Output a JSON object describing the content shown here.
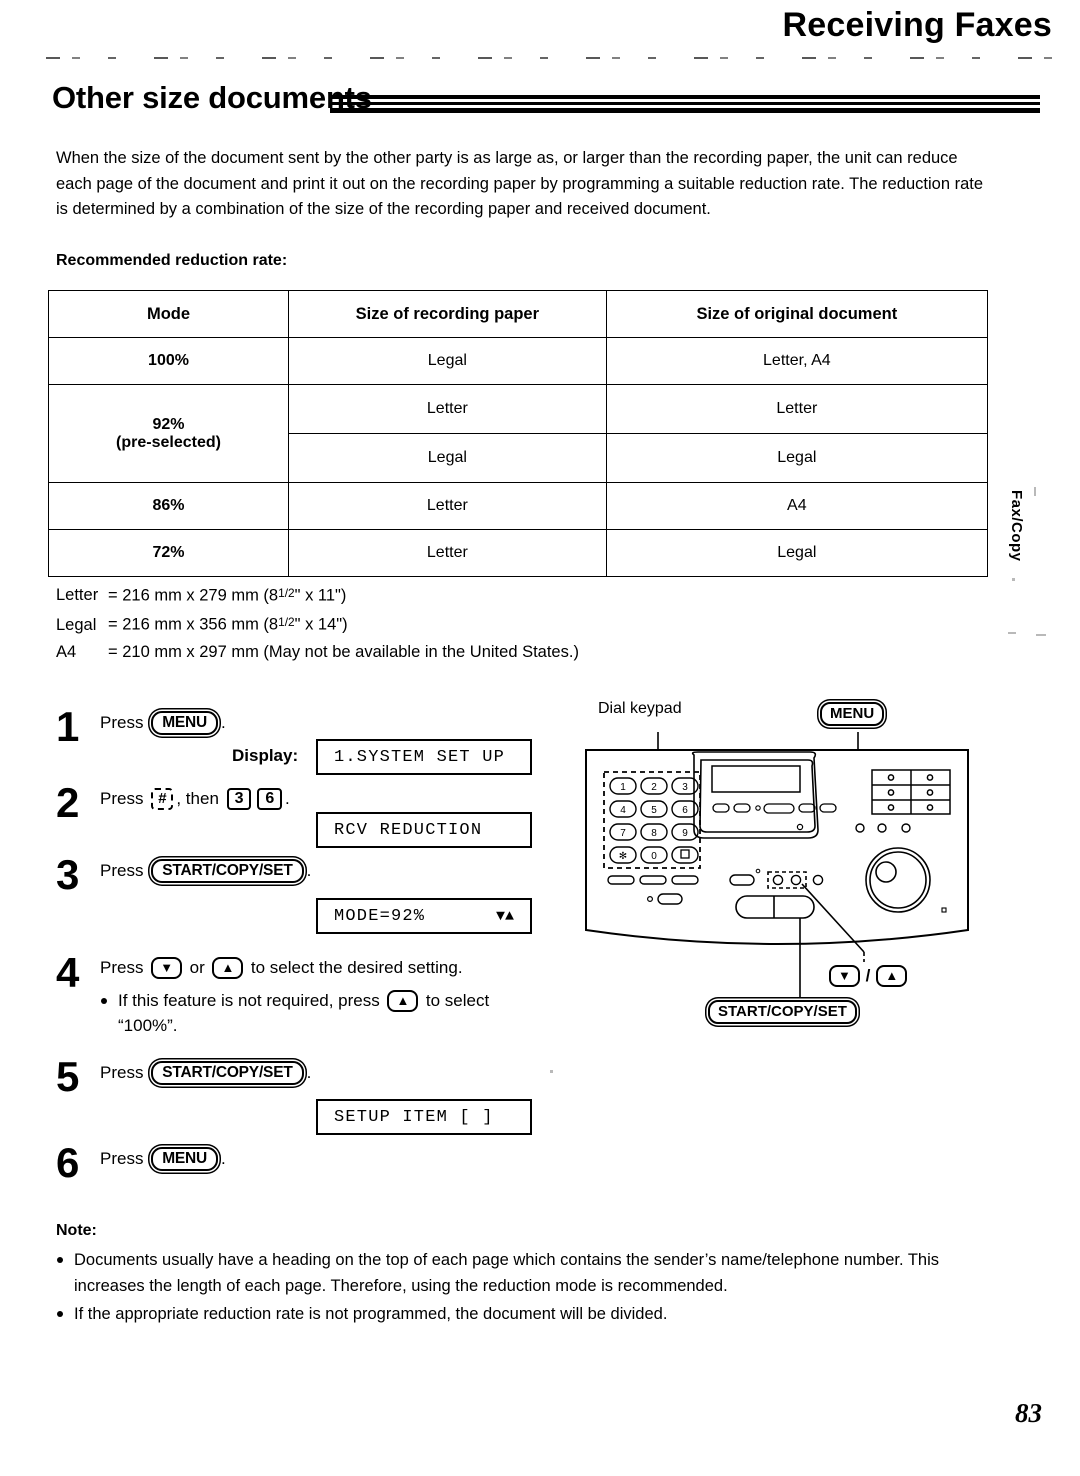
{
  "header": {
    "chapter_title": "Receiving Faxes",
    "section_title": "Other size documents"
  },
  "intro": {
    "paragraph1": "When the size of the document sent by the other party is as large as, or larger than the recording paper, the unit can reduce each page of the document and print it out on the recording paper by programming a suitable reduction rate.",
    "paragraph2": "The reduction rate is determined by a combination of the size of the recording paper and received document.",
    "table_label": "Recommended reduction rate:"
  },
  "table": {
    "headers": [
      "Mode",
      "Size of recording paper",
      "Size of original document"
    ],
    "rows": [
      {
        "mode": "100%",
        "mode_sub": "",
        "paper": "Legal",
        "original": "Letter, A4"
      },
      {
        "mode": "92%",
        "mode_sub": "(pre-selected)",
        "paper": "Letter",
        "original": "Letter"
      },
      {
        "mode": "",
        "mode_sub": "",
        "paper": "Legal",
        "original": "Legal"
      },
      {
        "mode": "86%",
        "mode_sub": "",
        "paper": "Letter",
        "original": "A4"
      },
      {
        "mode": "72%",
        "mode_sub": "",
        "paper": "Letter",
        "original": "Legal"
      }
    ]
  },
  "sizes": [
    {
      "name": "Letter",
      "eq": "= 216 mm x 279 mm (8",
      "frac": "1/2",
      "tail": "\" x 11\")"
    },
    {
      "name": "Legal",
      "eq": "= 216 mm x 356 mm (8",
      "frac": "1/2",
      "tail": "\" x 14\")"
    },
    {
      "name": "A4",
      "eq": "= 210 mm x 297 mm (May not be available in the United States.)",
      "frac": "",
      "tail": ""
    }
  ],
  "steps": {
    "s1": {
      "num": "1",
      "press": "Press",
      "key": "MENU",
      "period": ".",
      "display_label": "Display:",
      "lcd": "1.SYSTEM SET UP"
    },
    "s2": {
      "num": "2",
      "press": "Press",
      "key_hash": "#",
      "then": ", then",
      "key_a": "3",
      "key_b": "6",
      "period": ".",
      "lcd": "RCV REDUCTION"
    },
    "s3": {
      "num": "3",
      "press": "Press",
      "key": "START/COPY/SET",
      "period": ".",
      "lcd": "MODE=92%",
      "lcd_arrows": "▼▲"
    },
    "s4": {
      "num": "4",
      "line1_a": "Press",
      "key_down": "▼",
      "line1_b": "or",
      "key_up": "▲",
      "line1_c": "to select the desired setting.",
      "bullet_a": "If this feature is not required, press",
      "bullet_key": "▲",
      "bullet_b": "to select",
      "bullet_c": "“100%”."
    },
    "s5": {
      "num": "5",
      "press": "Press",
      "key": "START/COPY/SET",
      "period": ".",
      "lcd": "SETUP ITEM [  ]"
    },
    "s6": {
      "num": "6",
      "press": "Press",
      "key": "MENU",
      "period": "."
    }
  },
  "device": {
    "callouts": {
      "dial_keypad": "Dial keypad",
      "menu": "MENU",
      "start_copy_set": "START/COPY/SET",
      "down_key": "▼",
      "slash": "/",
      "up_key": "▲"
    },
    "keypad_keys": [
      "1",
      "2",
      "3",
      "4",
      "5",
      "6",
      "7",
      "8",
      "9",
      "*",
      "0",
      "#"
    ]
  },
  "note": {
    "heading": "Note:",
    "items": [
      "Documents usually have a heading on the top of each page which contains the sender’s name/telephone number. This increases the length of each page. Therefore, using the reduction mode is recommended.",
      "If the appropriate reduction rate is not programmed, the document will be divided."
    ]
  },
  "side_tab": "Fax/Copy",
  "page_number": "83"
}
